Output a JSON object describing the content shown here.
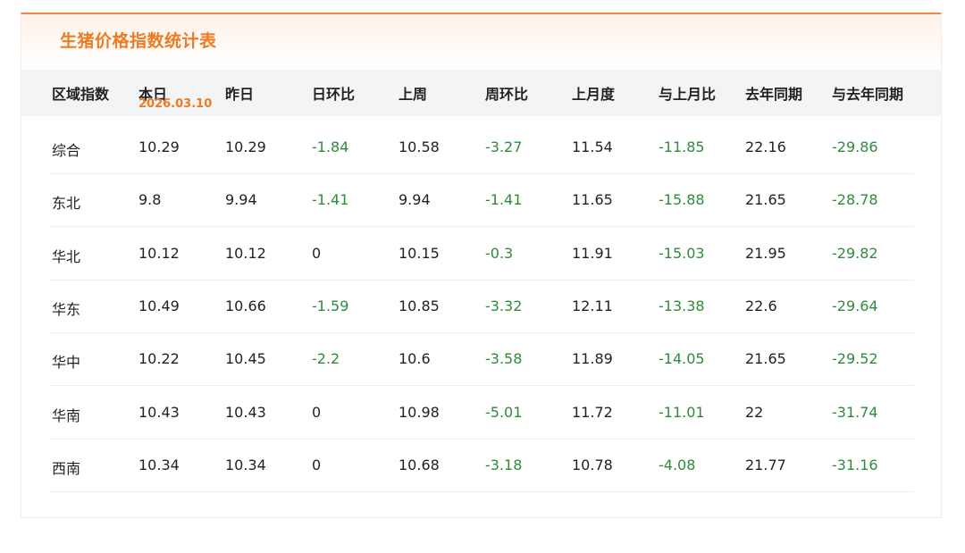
{
  "title": "生猪价格指数统计表",
  "columns": [
    "区域指数",
    "本日",
    "昨日",
    "日环比",
    "上周",
    "周环比",
    "上月度",
    "与上月比",
    "去年同期",
    "与去年同期"
  ],
  "today_date": "2026.03.10",
  "rows": [
    {
      "region": "综合",
      "today": "10.29",
      "yesterday": "10.29",
      "day_change": "-1.84",
      "last_week": "10.58",
      "week_change": "-3.27",
      "last_month": "11.54",
      "month_change": "-11.85",
      "last_year": "22.16",
      "year_change": "-29.86"
    },
    {
      "region": "东北",
      "today": "9.8",
      "yesterday": "9.94",
      "day_change": "-1.41",
      "last_week": "9.94",
      "week_change": "-1.41",
      "last_month": "11.65",
      "month_change": "-15.88",
      "last_year": "21.65",
      "year_change": "-28.78"
    },
    {
      "region": "华北",
      "today": "10.12",
      "yesterday": "10.12",
      "day_change": "0",
      "last_week": "10.15",
      "week_change": "-0.3",
      "last_month": "11.91",
      "month_change": "-15.03",
      "last_year": "21.95",
      "year_change": "-29.82"
    },
    {
      "region": "华东",
      "today": "10.49",
      "yesterday": "10.66",
      "day_change": "-1.59",
      "last_week": "10.85",
      "week_change": "-3.32",
      "last_month": "12.11",
      "month_change": "-13.38",
      "last_year": "22.6",
      "year_change": "-29.64"
    },
    {
      "region": "华中",
      "today": "10.22",
      "yesterday": "10.45",
      "day_change": "-2.2",
      "last_week": "10.6",
      "week_change": "-3.58",
      "last_month": "11.89",
      "month_change": "-14.05",
      "last_year": "21.65",
      "year_change": "-29.52"
    },
    {
      "region": "华南",
      "today": "10.43",
      "yesterday": "10.43",
      "day_change": "0",
      "last_week": "10.98",
      "week_change": "-5.01",
      "last_month": "11.72",
      "month_change": "-11.01",
      "last_year": "22",
      "year_change": "-31.74"
    },
    {
      "region": "西南",
      "today": "10.34",
      "yesterday": "10.34",
      "day_change": "0",
      "last_week": "10.68",
      "week_change": "-3.18",
      "last_month": "10.78",
      "month_change": "-4.08",
      "last_year": "21.77",
      "year_change": "-31.16"
    }
  ],
  "colors": {
    "accent": "#ee7a22",
    "negative": "#2e8b3a",
    "header_bg": "#f3f4f6",
    "text": "#222222"
  }
}
